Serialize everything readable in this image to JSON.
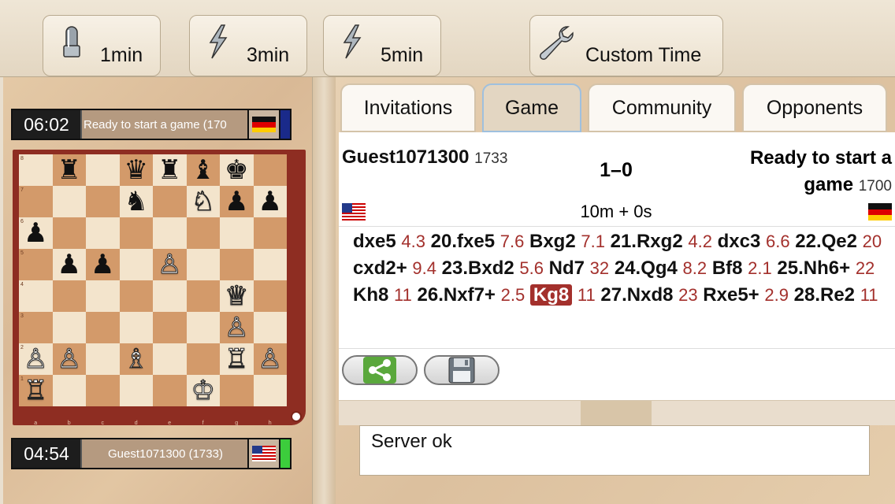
{
  "toolbar": {
    "buttons": [
      {
        "label": "1min",
        "icon": "bullet-icon"
      },
      {
        "label": "3min",
        "icon": "lightning-icon"
      },
      {
        "label": "5min",
        "icon": "lightning-icon"
      },
      {
        "label": "Custom Time",
        "icon": "wrench-icon"
      }
    ]
  },
  "top_player": {
    "clock": "06:02",
    "name": "Ready to start a game (170",
    "flag": "de",
    "indicator_color": "#1a2a8a"
  },
  "bottom_player": {
    "clock": "04:54",
    "name": "Guest1071300 (1733)",
    "flag": "us",
    "indicator_color": "#3ccd3c"
  },
  "board": {
    "orientation": "white-bottom",
    "rows": [
      [
        "",
        "r",
        "",
        "q",
        "r",
        "b",
        "k",
        ""
      ],
      [
        "",
        "",
        "",
        "n",
        "",
        "N",
        "p",
        "p"
      ],
      [
        "p",
        "",
        "",
        "",
        "",
        "",
        "",
        ""
      ],
      [
        "",
        "p",
        "p",
        "",
        "P",
        "",
        "",
        ""
      ],
      [
        "",
        "",
        "",
        "",
        "",
        "",
        "Q",
        ""
      ],
      [
        "",
        "",
        "",
        "",
        "",
        "",
        "P",
        ""
      ],
      [
        "P",
        "P",
        "",
        "B",
        "",
        "",
        "R",
        "P"
      ],
      [
        "R",
        "",
        "",
        "",
        "",
        "K",
        "",
        ""
      ]
    ],
    "files": [
      "a",
      "b",
      "c",
      "d",
      "e",
      "f",
      "g",
      "h"
    ],
    "ranks": [
      "8",
      "7",
      "6",
      "5",
      "4",
      "3",
      "2",
      "1"
    ]
  },
  "tabs": [
    {
      "label": "Invitations",
      "active": false
    },
    {
      "label": "Game",
      "active": true
    },
    {
      "label": "Community",
      "active": false
    },
    {
      "label": "Opponents",
      "active": false
    }
  ],
  "game": {
    "white_name": "Guest1071300",
    "white_rating": "1733",
    "result": "1–0",
    "black_name_line1": "Ready to start a",
    "black_name_line2": "game",
    "black_rating": "1700",
    "time_control": "10m + 0s",
    "white_flag": "us",
    "black_flag": "de",
    "moves": [
      {
        "text": "dxe5",
        "time": "4.3"
      },
      {
        "text": "20.fxe5",
        "time": "7.6"
      },
      {
        "text": "Bxg2",
        "time": "7.1"
      },
      {
        "text": "21.Rxg2",
        "time": "4.2"
      },
      {
        "text": "dxc3",
        "time": "6.6"
      },
      {
        "text": "22.Qe2",
        "time": "20"
      },
      {
        "text": "cxd2+",
        "time": "9.4"
      },
      {
        "text": "23.Bxd2",
        "time": "5.6"
      },
      {
        "text": "Nd7",
        "time": "32"
      },
      {
        "text": "24.Qg4",
        "time": "8.2"
      },
      {
        "text": "Bf8",
        "time": "2.1"
      },
      {
        "text": "25.Nh6+",
        "time": "22"
      },
      {
        "text": "Kh8",
        "time": "11"
      },
      {
        "text": "26.Nxf7+",
        "time": "2.5"
      },
      {
        "text": "Kg8",
        "time": "11",
        "current": true
      },
      {
        "text": "27.Nxd8",
        "time": "23"
      },
      {
        "text": "Rxe5+",
        "time": "2.9"
      },
      {
        "text": "28.Re2",
        "time": "11"
      }
    ]
  },
  "status_text": "Server ok",
  "colors": {
    "accent_red": "#a3302c",
    "board_frame": "#8e2d22",
    "light_square": "#f3e4cc",
    "dark_square": "#d39a6a"
  }
}
